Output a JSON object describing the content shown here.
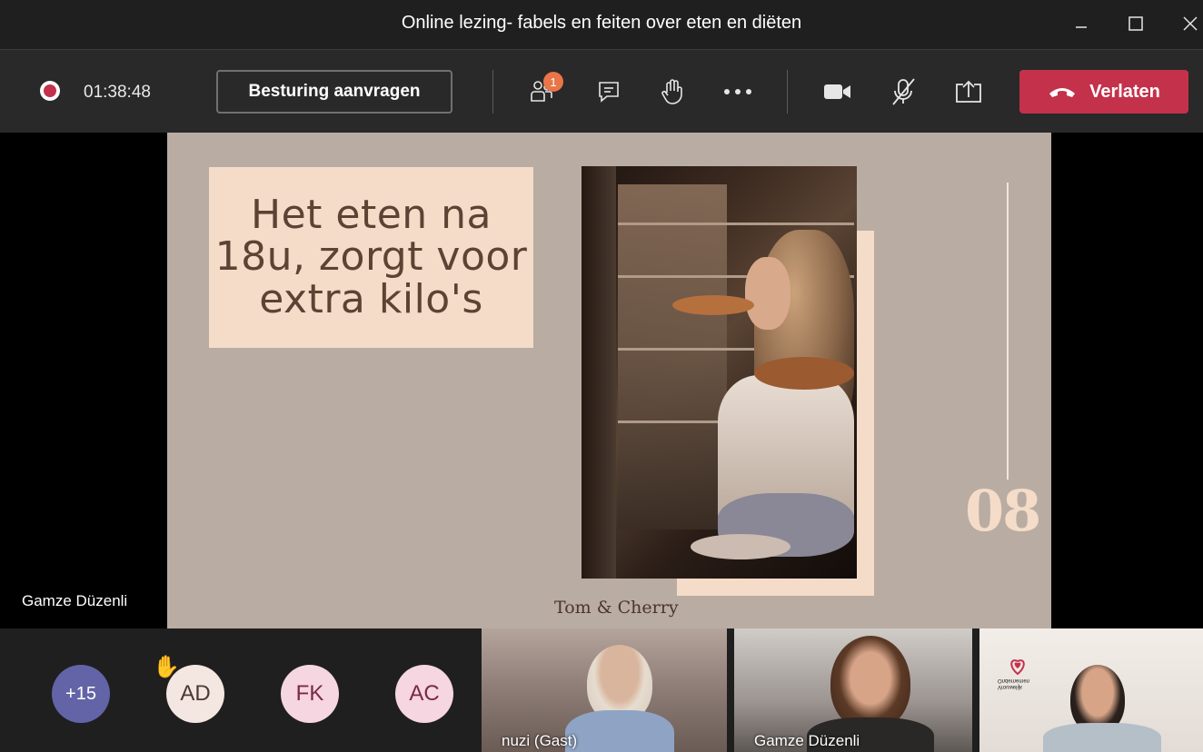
{
  "window": {
    "title": "Online lezing- fabels en feiten over eten en diëten"
  },
  "toolbar": {
    "timer": "01:38:48",
    "request_control_label": "Besturing aanvragen",
    "participants_badge": "1",
    "leave_label": "Verlaten"
  },
  "slide": {
    "title": "Het eten na 18u, zorgt voor extra kilo's",
    "number": "08",
    "brand": "Tom & Cherry"
  },
  "presenter": {
    "name": "Gamze Düzenli"
  },
  "participants": {
    "overflow": "+15",
    "avatars": [
      {
        "initials": "AD",
        "color": "#f4e6e1"
      },
      {
        "initials": "FK",
        "color": "#f6d6e0"
      },
      {
        "initials": "AC",
        "color": "#f6d6e0"
      }
    ],
    "videos": [
      {
        "name": "nuzi (Gast)"
      },
      {
        "name": "Gamze Düzenli"
      }
    ],
    "logo_text": [
      "Vrouwelijk",
      "Ondernemen"
    ]
  },
  "colors": {
    "leave": "#c4314b",
    "badge": "#e97548",
    "overflow_avatar": "#6264a7",
    "slide_bg": "#b9aca3",
    "slide_accent": "#f4dcc8"
  },
  "icons": [
    "record-icon",
    "participants-icon",
    "chat-icon",
    "raise-hand-icon",
    "more-icon",
    "camera-icon",
    "mic-off-icon",
    "share-icon",
    "hangup-icon",
    "minimize-icon",
    "maximize-icon",
    "close-icon"
  ]
}
